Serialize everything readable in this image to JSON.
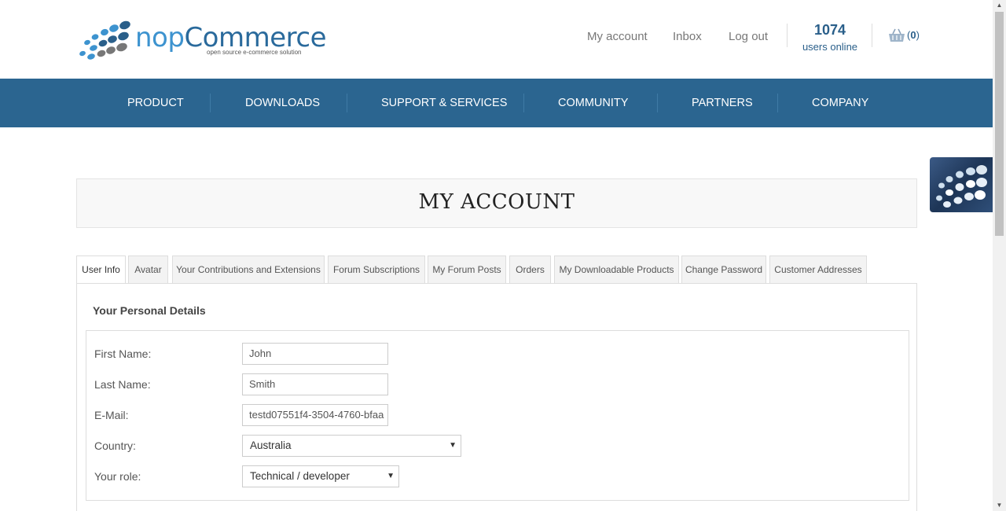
{
  "brand": {
    "name_part1": "nop",
    "name_part2": "Commerce",
    "tagline": "open source e-commerce solution"
  },
  "header": {
    "links": [
      "My account",
      "Inbox",
      "Log out"
    ],
    "users_online_count": "1074",
    "users_online_label": "users online",
    "cart_open": "(",
    "cart_count": "0",
    "cart_close": ")"
  },
  "nav": {
    "items": [
      "PRODUCT",
      "DOWNLOADS",
      "SUPPORT & SERVICES",
      "COMMUNITY",
      "PARTNERS",
      "COMPANY"
    ]
  },
  "page": {
    "title": "MY ACCOUNT"
  },
  "tabs": [
    "User Info",
    "Avatar",
    "Your Contributions and Extensions",
    "Forum Subscriptions",
    "My Forum Posts",
    "Orders",
    "My Downloadable Products",
    "Change Password",
    "Customer Addresses"
  ],
  "active_tab": "User Info",
  "form": {
    "section_title": "Your Personal Details",
    "first_name_label": "First Name:",
    "first_name_value": "John",
    "last_name_label": "Last Name:",
    "last_name_value": "Smith",
    "email_label": "E-Mail:",
    "email_value": "testd07551f4-3504-4760-bfaa",
    "country_label": "Country:",
    "country_value": "Australia",
    "role_label": "Your role:",
    "role_value": "Technical / developer"
  },
  "colors": {
    "nav_bg": "#2b6590",
    "brand_blue": "#2a6a9c",
    "brand_light_blue": "#3d93cf"
  },
  "icons": {
    "cart": "shopping-basket-icon",
    "dropdown": "caret-down-icon",
    "logo": "dots-logo-icon"
  }
}
